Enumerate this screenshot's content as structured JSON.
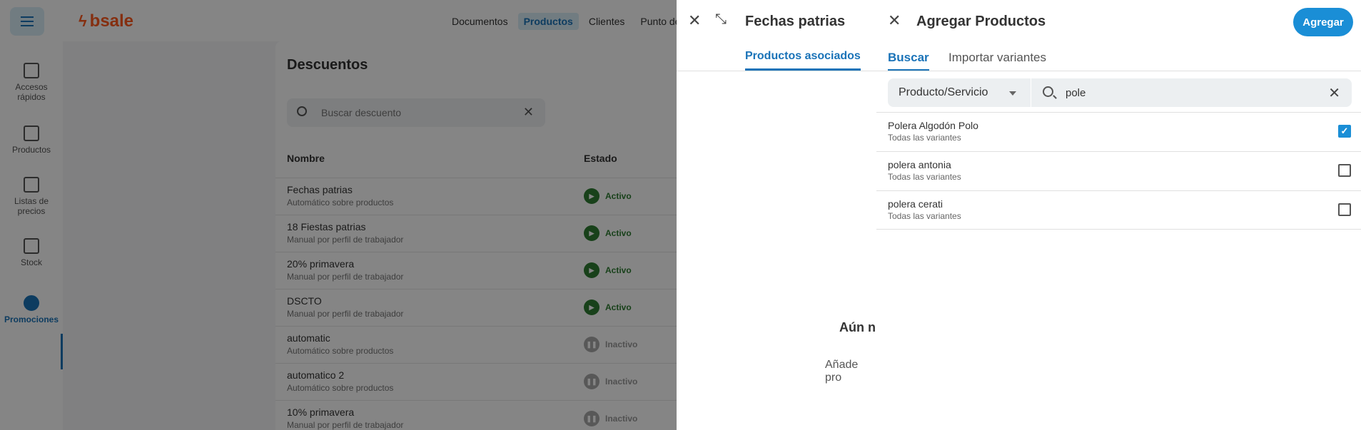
{
  "topbar": {
    "logo": "bsale",
    "nav": [
      {
        "label": "Documentos",
        "active": false
      },
      {
        "label": "Productos",
        "active": true
      },
      {
        "label": "Clientes",
        "active": false
      },
      {
        "label": "Punto de",
        "active": false
      }
    ]
  },
  "sidebar": {
    "items": [
      {
        "label": "Accesos rápidos",
        "icon": "quick-access-icon"
      },
      {
        "label": "Productos",
        "icon": "products-icon"
      },
      {
        "label": "Listas de precios",
        "icon": "price-list-icon"
      },
      {
        "label": "Stock",
        "icon": "stock-icon"
      },
      {
        "label": "Promociones",
        "icon": "promotions-icon",
        "active": true
      }
    ]
  },
  "descuentos": {
    "title": "Descuentos",
    "search_placeholder": "Buscar descuento",
    "columns": [
      "Nombre",
      "Estado"
    ],
    "rows": [
      {
        "name": "Fechas patrias",
        "sub": "Automático sobre productos",
        "status": "Activo",
        "active": true
      },
      {
        "name": "18 Fiestas patrias",
        "sub": "Manual por perfil de trabajador",
        "status": "Activo",
        "active": true
      },
      {
        "name": "20% primavera",
        "sub": "Manual por perfil de trabajador",
        "status": "Activo",
        "active": true
      },
      {
        "name": "DSCTO",
        "sub": "Manual por perfil de trabajador",
        "status": "Activo",
        "active": true
      },
      {
        "name": "automatic",
        "sub": "Automático sobre productos",
        "status": "Inactivo",
        "active": false
      },
      {
        "name": "automatico 2",
        "sub": "Automático sobre productos",
        "status": "Inactivo",
        "active": false
      },
      {
        "name": "10% primavera",
        "sub": "Manual por perfil de trabajador",
        "status": "Inactivo",
        "active": false
      }
    ]
  },
  "drawer_discount": {
    "title": "Fechas patrias",
    "tab": "Productos asociados",
    "empty_title": "Aún n",
    "empty_hint": "Añade pro"
  },
  "drawer_add": {
    "title": "Agregar Productos",
    "add_button": "Agregar",
    "tabs": [
      "Buscar",
      "Importar variantes"
    ],
    "filter_type": "Producto/Servicio",
    "search_value": "pole",
    "results": [
      {
        "name": "Polera Algodón Polo",
        "sub": "Todas las variantes",
        "checked": true
      },
      {
        "name": "polera antonia",
        "sub": "Todas las variantes",
        "checked": false
      },
      {
        "name": "polera cerati",
        "sub": "Todas las variantes",
        "checked": false
      }
    ]
  },
  "colors": {
    "accent": "#1a8ed6",
    "brand": "#ff5a1f",
    "active_status": "#2e7d32"
  }
}
